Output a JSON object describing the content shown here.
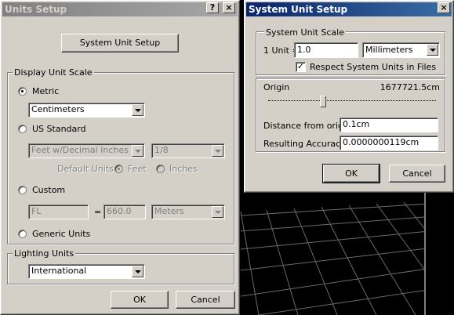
{
  "units_setup": {
    "title": "Units Setup",
    "help_btn": "?",
    "close_btn": "×",
    "system_unit_setup_btn": "System Unit Setup",
    "display_group": "Display Unit Scale",
    "metric_label": "Metric",
    "metric_value": "Centimeters",
    "us_label": "US Standard",
    "us_value": "Feet w/Decimal Inches",
    "fraction_value": "1/8",
    "default_units_label": "Default Units:",
    "feet_label": "Feet",
    "inches_label": "Inches",
    "custom_label": "Custom",
    "custom_name": "FL",
    "equals": "=",
    "custom_amount": "660.0",
    "custom_unit": "Meters",
    "generic_label": "Generic Units",
    "lighting_group": "Lighting Units",
    "lighting_value": "International",
    "ok": "OK",
    "cancel": "Cancel"
  },
  "system_unit_setup": {
    "title": "System Unit Setup",
    "close_btn": "×",
    "scale_group": "System Unit Scale",
    "one_unit_label": "1 Unit =",
    "unit_value": "1.0",
    "unit_type": "Millimeters",
    "respect_label": "Respect System Units in Files",
    "respect_checked": true,
    "check_mark": "✓",
    "origin_label": "Origin",
    "origin_value": "1677721.5cm",
    "distance_label": "Distance from origin:",
    "distance_value": "0.1cm",
    "accuracy_label": "Resulting Accuracy:",
    "accuracy_value": "0.0000000119cm",
    "ok": "OK",
    "cancel": "Cancel"
  }
}
